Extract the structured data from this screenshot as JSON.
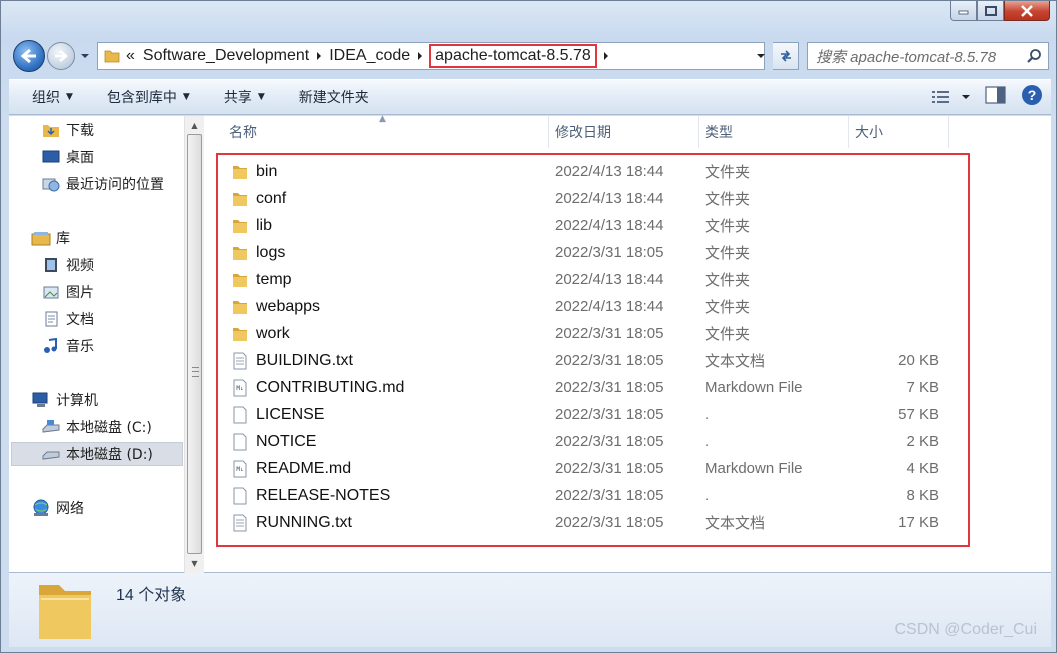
{
  "window": {
    "controls": [
      "minimize",
      "maximize",
      "close"
    ]
  },
  "address": {
    "breadcrumb_prefix": "«",
    "crumbs": [
      "Software_Development",
      "IDEA_code",
      "apache-tomcat-8.5.78"
    ],
    "search_placeholder": "搜索 apache-tomcat-8.5.78"
  },
  "toolbar": {
    "organize": "组织",
    "include_library": "包含到库中",
    "share": "共享",
    "new_folder": "新建文件夹"
  },
  "nav": {
    "favorites": [
      "下载",
      "桌面",
      "最近访问的位置"
    ],
    "library": "库",
    "library_items": [
      "视频",
      "图片",
      "文档",
      "音乐"
    ],
    "computer": "计算机",
    "drives": [
      "本地磁盘 (C:)",
      "本地磁盘 (D:)"
    ],
    "network": "网络"
  },
  "columns": {
    "name": "名称",
    "modified": "修改日期",
    "type": "类型",
    "size": "大小"
  },
  "files": [
    {
      "name": "bin",
      "modified": "2022/4/13 18:44",
      "type": "文件夹",
      "size": "",
      "icon": "folder-icon"
    },
    {
      "name": "conf",
      "modified": "2022/4/13 18:44",
      "type": "文件夹",
      "size": "",
      "icon": "folder-icon"
    },
    {
      "name": "lib",
      "modified": "2022/4/13 18:44",
      "type": "文件夹",
      "size": "",
      "icon": "folder-icon"
    },
    {
      "name": "logs",
      "modified": "2022/3/31 18:05",
      "type": "文件夹",
      "size": "",
      "icon": "folder-icon"
    },
    {
      "name": "temp",
      "modified": "2022/4/13 18:44",
      "type": "文件夹",
      "size": "",
      "icon": "folder-icon"
    },
    {
      "name": "webapps",
      "modified": "2022/4/13 18:44",
      "type": "文件夹",
      "size": "",
      "icon": "folder-icon"
    },
    {
      "name": "work",
      "modified": "2022/3/31 18:05",
      "type": "文件夹",
      "size": "",
      "icon": "folder-icon"
    },
    {
      "name": "BUILDING.txt",
      "modified": "2022/3/31 18:05",
      "type": "文本文档",
      "size": "20 KB",
      "icon": "text-file-icon"
    },
    {
      "name": "CONTRIBUTING.md",
      "modified": "2022/3/31 18:05",
      "type": "Markdown File",
      "size": "7 KB",
      "icon": "markdown-file-icon"
    },
    {
      "name": "LICENSE",
      "modified": "2022/3/31 18:05",
      "type": ".",
      "size": "57 KB",
      "icon": "blank-file-icon"
    },
    {
      "name": "NOTICE",
      "modified": "2022/3/31 18:05",
      "type": ".",
      "size": "2 KB",
      "icon": "blank-file-icon"
    },
    {
      "name": "README.md",
      "modified": "2022/3/31 18:05",
      "type": "Markdown File",
      "size": "4 KB",
      "icon": "markdown-file-icon"
    },
    {
      "name": "RELEASE-NOTES",
      "modified": "2022/3/31 18:05",
      "type": ".",
      "size": "8 KB",
      "icon": "blank-file-icon"
    },
    {
      "name": "RUNNING.txt",
      "modified": "2022/3/31 18:05",
      "type": "文本文档",
      "size": "17 KB",
      "icon": "text-file-icon"
    }
  ],
  "details": {
    "count": "14 个对象"
  },
  "watermark": "CSDN @Coder_Cui",
  "colors": {
    "highlight": "#e0363c",
    "folder": "#e8b84a"
  }
}
